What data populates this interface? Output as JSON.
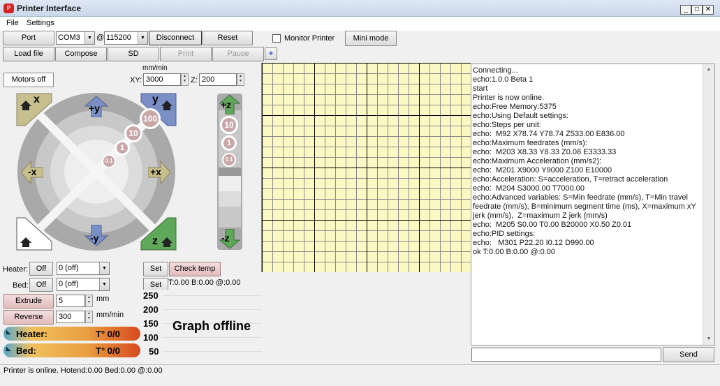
{
  "window": {
    "app_icon": "printrun-icon",
    "title": "Printer Interface",
    "minimize": "_",
    "maximize": "□",
    "close": "✕"
  },
  "menu": [
    "File",
    "Settings"
  ],
  "toolbar": {
    "port_label": "Port",
    "port_value": "COM3",
    "at": "@",
    "baud_value": "115200",
    "disconnect": "Disconnect",
    "reset": "Reset",
    "monitor_printer": "Monitor Printer",
    "mini_mode": "Mini mode",
    "load_file": "Load file",
    "compose": "Compose",
    "sd": "SD",
    "print": "Print",
    "pause": "Pause",
    "plus": "+"
  },
  "movement": {
    "motors_off": "Motors off",
    "feed_unit": "mm/min",
    "xy_label": "XY:",
    "xy_value": "3000",
    "z_label": "Z:",
    "z_value": "200",
    "home_x": "x",
    "home_y": "y",
    "home_z": "z",
    "plus_y": "+y",
    "minus_y": "-y",
    "minus_x": "-x",
    "plus_x": "+x",
    "plus_z": "+z",
    "minus_z": "-z",
    "steps": [
      "100",
      "10",
      "1",
      "0.1"
    ],
    "z_steps": [
      "10",
      "1",
      "0.1"
    ]
  },
  "temperature": {
    "heater_label": "Heater:",
    "heater_off": "Off",
    "heater_value": "0 (off)",
    "bed_label": "Bed:",
    "bed_off": "Off",
    "bed_value": "0 (off)",
    "set1": "Set",
    "set2": "Set",
    "check_temp": "Check temp",
    "readout": "T:0.00 B:0.00 @:0.00"
  },
  "extrude": {
    "extrude": "Extrude",
    "extrude_value": "5",
    "extrude_unit": "mm",
    "reverse": "Reverse",
    "reverse_value": "300",
    "reverse_unit": "mm/min"
  },
  "gauges": {
    "heater_label": "Heater:",
    "heater_value": "T° 0/0",
    "bed_label": "Bed:",
    "bed_value": "T° 0/0"
  },
  "graph": {
    "ticks": [
      "250",
      "200",
      "150",
      "100",
      "50"
    ],
    "offline_text": "Graph offline"
  },
  "console": {
    "lines": [
      "Connecting...",
      "echo:1.0.0 Beta 1",
      "start",
      "Printer is now online.",
      "echo:Free Memory:5375",
      "echo:Using Default settings:",
      "echo:Steps per unit:",
      "echo:  M92 X78.74 Y78.74 Z533.00 E836.00",
      "echo:Maximum feedrates (mm/s):",
      "echo:  M203 X8.33 Y8.33 Z0.08 E3333.33",
      "echo:Maximum Acceleration (mm/s2):",
      "echo:  M201 X9000 Y9000 Z100 E10000",
      "echo:Acceleration: S=acceleration, T=retract acceleration",
      "echo:  M204 S3000.00 T7000.00",
      "echo:Advanced variables: S=Min feedrate (mm/s), T=Min travel feedrate (mm/s), B=minimum segment time (ms), X=maximum xY jerk (mm/s),  Z=maximum Z jerk (mm/s)",
      "echo:  M205 S0.00 T0.00 B20000 X0.50 Z0.01",
      "echo:PID settings:",
      "echo:   M301 P22.20 I0.12 D990.00",
      "ok T:0.00 B:0.00 @:0.00"
    ],
    "command_value": "",
    "send": "Send"
  },
  "status": "Printer is online. Hotend:0.00 Bed:0.00 @:0.00",
  "colors": {
    "grid_bg": "#fcf8c4",
    "extrude_pink": "#e2bcbc",
    "arrow_blue": "#7a8fc6",
    "arrow_tan": "#c8bf8e",
    "home_green": "#5fa85a"
  }
}
